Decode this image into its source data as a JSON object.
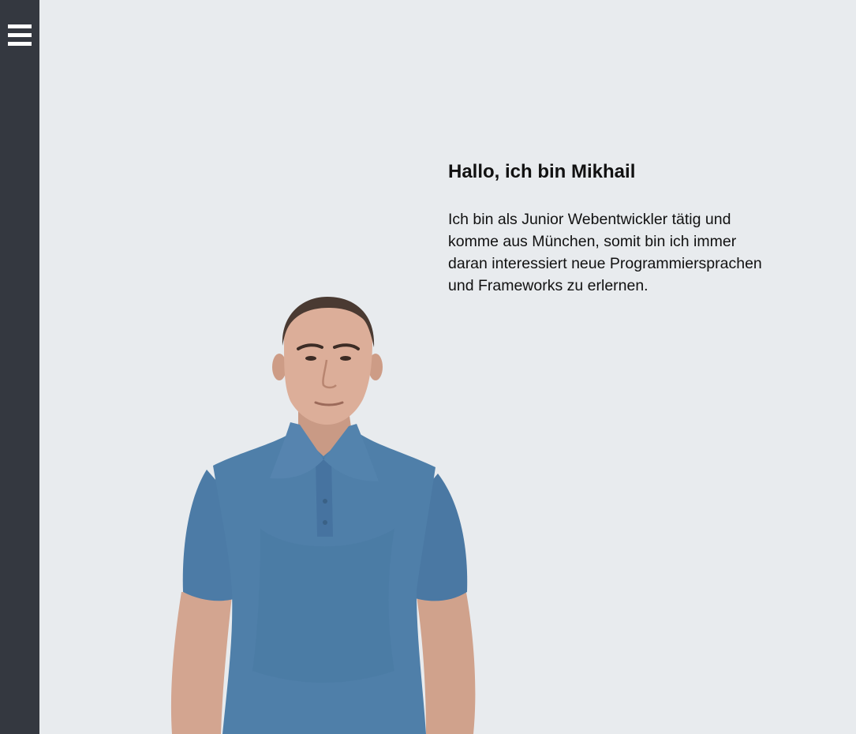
{
  "sidebar": {
    "menu_icon": "hamburger-menu-icon",
    "background": "#343840"
  },
  "intro": {
    "heading": "Hallo, ich bin Mikhail",
    "text": "Ich bin als Junior Webentwickler tätig und komme aus München, somit bin ich immer daran interessiert neue Programmiersprachen und Frameworks zu erlernen."
  },
  "colors": {
    "page_background": "#e8ebee",
    "shirt": "#4f7fa9"
  }
}
